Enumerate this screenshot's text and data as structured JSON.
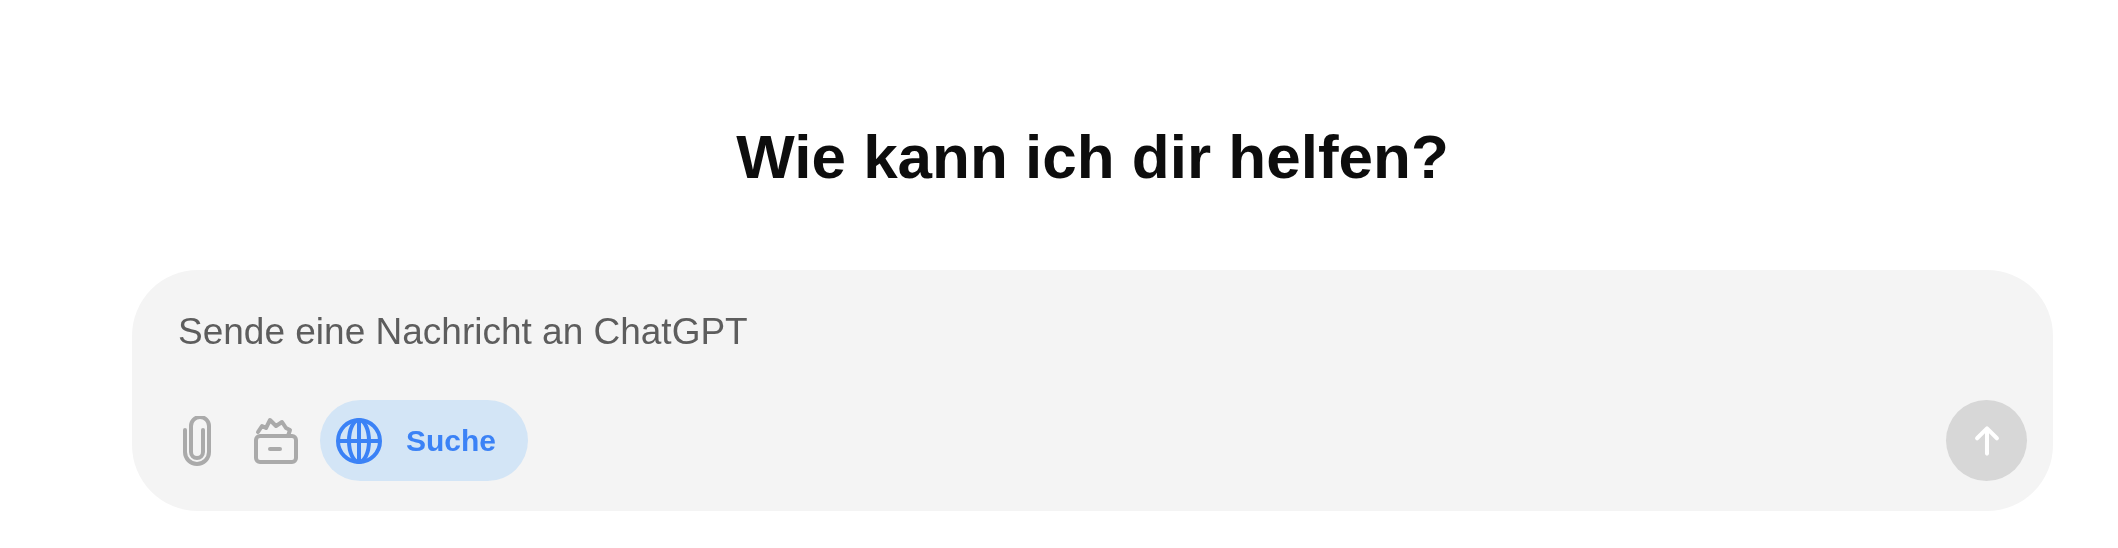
{
  "heading": "Wie kann ich dir helfen?",
  "composer": {
    "placeholder": "Sende eine Nachricht an ChatGPT",
    "search_toggle": {
      "label": "Suche",
      "selected": true
    },
    "send_button": {
      "disabled": true
    }
  }
}
